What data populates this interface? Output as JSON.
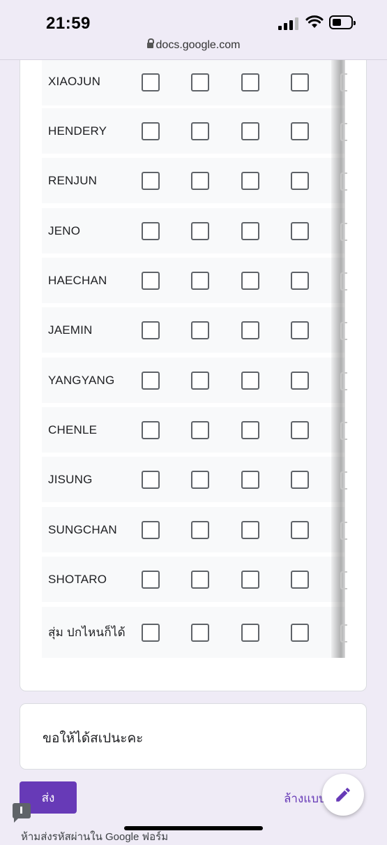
{
  "status_bar": {
    "time": "21:59",
    "url": "docs.google.com"
  },
  "grid": {
    "rows": [
      {
        "label": "XIAOJUN"
      },
      {
        "label": "HENDERY"
      },
      {
        "label": "RENJUN"
      },
      {
        "label": "JENO"
      },
      {
        "label": "HAECHAN"
      },
      {
        "label": "JAEMIN"
      },
      {
        "label": "YANGYANG"
      },
      {
        "label": "CHENLE"
      },
      {
        "label": "JISUNG"
      },
      {
        "label": "SUNGCHAN"
      },
      {
        "label": "SHOTARO"
      },
      {
        "label": "สุ่ม ปกไหนก็ได้"
      }
    ]
  },
  "question2": {
    "label": "ขอให้ได้สเปนะคะ"
  },
  "footer": {
    "submit_label": "ส่ง",
    "clear_label": "ล้างแบบ",
    "note": "ห้ามส่งรหัสผ่านใน Google ฟอร์ม"
  },
  "icons": {
    "fab": "pencil-icon",
    "report": "report-flag-icon",
    "lock": "lock-icon"
  },
  "colors": {
    "accent": "#673ab7",
    "background": "#efebf6"
  }
}
